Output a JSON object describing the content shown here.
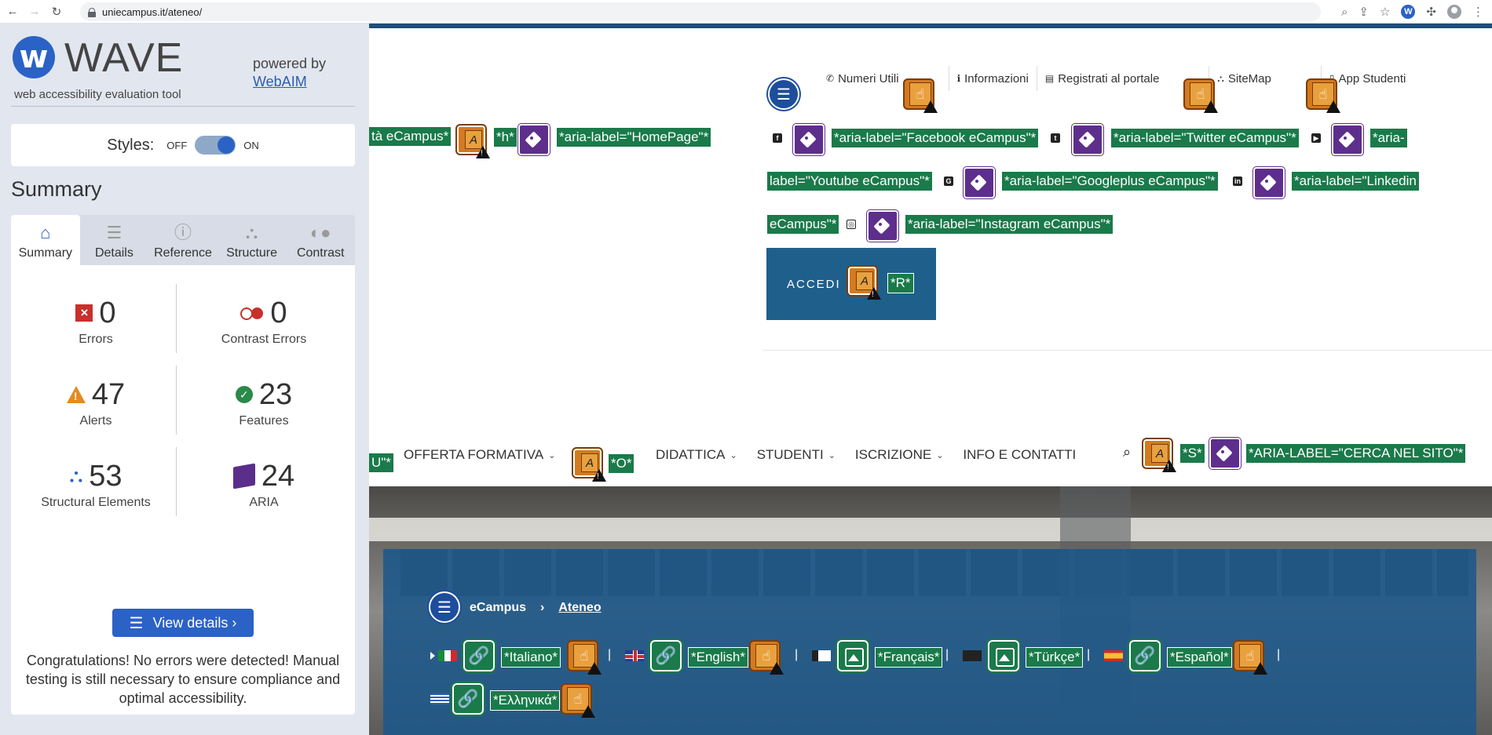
{
  "browser": {
    "url": "uniecampus.it/ateneo/",
    "back_icon": "back-arrow-icon",
    "forward_icon": "forward-arrow-icon",
    "reload_icon": "reload-icon",
    "ext_w": "W"
  },
  "wave": {
    "title": "WAVE",
    "logo_letter": "w",
    "subtitle": "web accessibility evaluation tool",
    "powered_by": "powered by",
    "webaim": "WebAIM",
    "styles_label": "Styles:",
    "styles_off": "OFF",
    "styles_on": "ON",
    "summary_heading": "Summary",
    "tabs": [
      {
        "label": "Summary",
        "icon": "home-icon"
      },
      {
        "label": "Details",
        "icon": "list-icon"
      },
      {
        "label": "Reference",
        "icon": "info-icon"
      },
      {
        "label": "Structure",
        "icon": "structure-icon"
      },
      {
        "label": "Contrast",
        "icon": "contrast-icon"
      }
    ],
    "stats": {
      "errors": {
        "value": "0",
        "label": "Errors"
      },
      "contrast": {
        "value": "0",
        "label": "Contrast Errors"
      },
      "alerts": {
        "value": "47",
        "label": "Alerts"
      },
      "features": {
        "value": "23",
        "label": "Features"
      },
      "structural": {
        "value": "53",
        "label": "Structural Elements"
      },
      "aria": {
        "value": "24",
        "label": "ARIA"
      }
    },
    "view_details": "View details ›",
    "congrats": "Congratulations! No errors were detected! Manual testing is still necessary to ensure compliance and optimal accessibility."
  },
  "page": {
    "header_tags": {
      "logo_text": "tà eCampus*",
      "h": "*h*",
      "homepage": "*aria-label=\"HomePage\"*"
    },
    "toplinks": [
      {
        "label": "Numeri Utili",
        "icon": "phone-icon"
      },
      {
        "label": "Informazioni",
        "icon": "info-icon"
      },
      {
        "label": "Registrati al portale",
        "icon": "id-card-icon"
      },
      {
        "label": "SiteMap",
        "icon": "sitemap-icon"
      },
      {
        "label": "App Studenti",
        "icon": "mobile-icon"
      }
    ],
    "social": {
      "facebook": "*aria-label=\"Facebook eCampus\"*",
      "twitter": "*aria-label=\"Twitter eCampus\"*",
      "youtube_a": "*aria-",
      "youtube_b": "label=\"Youtube eCampus\"*",
      "googleplus": "*aria-label=\"Googleplus eCampus\"*",
      "linkedin_a": "*aria-label=\"Linkedin",
      "linkedin_b": "eCampus\"*",
      "instagram": "*aria-label=\"Instagram eCampus\"*"
    },
    "accedi": "ACCEDI",
    "accedi_key": "*R*",
    "nav": {
      "cut_tag": "U\"*",
      "items": [
        {
          "label": "OFFERTA FORMATIVA"
        },
        {
          "label": "DIDATTICA"
        },
        {
          "label": "STUDENTI"
        },
        {
          "label": "ISCRIZIONE"
        },
        {
          "label": "INFO E CONTATTI"
        }
      ],
      "o_key": "*O*",
      "s_key": "*S*",
      "search_label": "*ARIA-LABEL=\"CERCA NEL SITO\"*"
    },
    "breadcrumb": {
      "home": "eCampus",
      "sep": "›",
      "current": "Ateneo"
    },
    "languages": [
      {
        "label": "*Italiano*"
      },
      {
        "label": "*English*"
      },
      {
        "label": "*Français*"
      },
      {
        "label": "*Türkçe*"
      },
      {
        "label": "*Español*"
      },
      {
        "label": "*Ελληνικά*"
      }
    ],
    "lang_sep": "|"
  }
}
